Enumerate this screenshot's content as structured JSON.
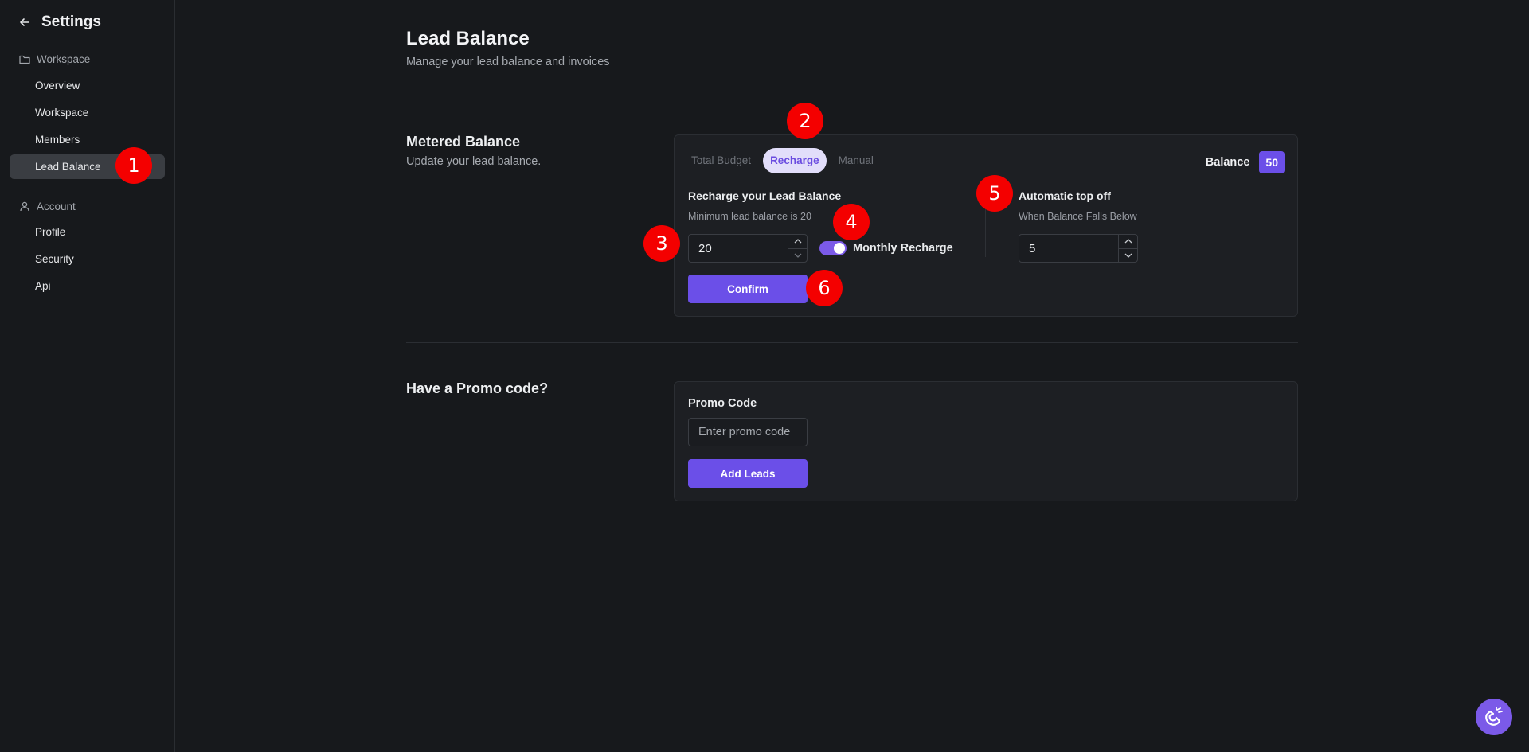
{
  "sidebar": {
    "title": "Settings",
    "sections": {
      "workspace": {
        "label": "Workspace",
        "items": [
          "Overview",
          "Workspace",
          "Members",
          "Lead Balance"
        ]
      },
      "account": {
        "label": "Account",
        "items": [
          "Profile",
          "Security",
          "Api"
        ]
      }
    },
    "active_item": "Lead Balance"
  },
  "page": {
    "title": "Lead Balance",
    "subtitle": "Manage your lead balance and invoices"
  },
  "metered": {
    "title": "Metered Balance",
    "description": "Update your lead balance.",
    "tabs": [
      "Total Budget",
      "Recharge",
      "Manual"
    ],
    "active_tab": "Recharge",
    "balance_label": "Balance",
    "balance_value": "50",
    "recharge": {
      "title": "Recharge your Lead Balance",
      "hint": "Minimum lead balance is 20",
      "value": "20",
      "toggle_label": "Monthly Recharge",
      "toggle_on": true,
      "confirm_label": "Confirm"
    },
    "topoff": {
      "title": "Automatic top off",
      "hint": "When Balance Falls Below",
      "value": "5"
    }
  },
  "promo": {
    "title": "Have a Promo code?",
    "label": "Promo Code",
    "placeholder": "Enter promo code",
    "button_label": "Add Leads"
  },
  "markers": [
    "1",
    "2",
    "3",
    "4",
    "5",
    "6"
  ],
  "colors": {
    "accent": "#6b4fe8",
    "background": "#17191c",
    "card": "#1d1f23",
    "marker": "#f40000"
  },
  "icons": {
    "back": "arrow-left-icon",
    "workspace": "folder-icon",
    "account": "user-icon",
    "fab": "magnet-icon"
  }
}
